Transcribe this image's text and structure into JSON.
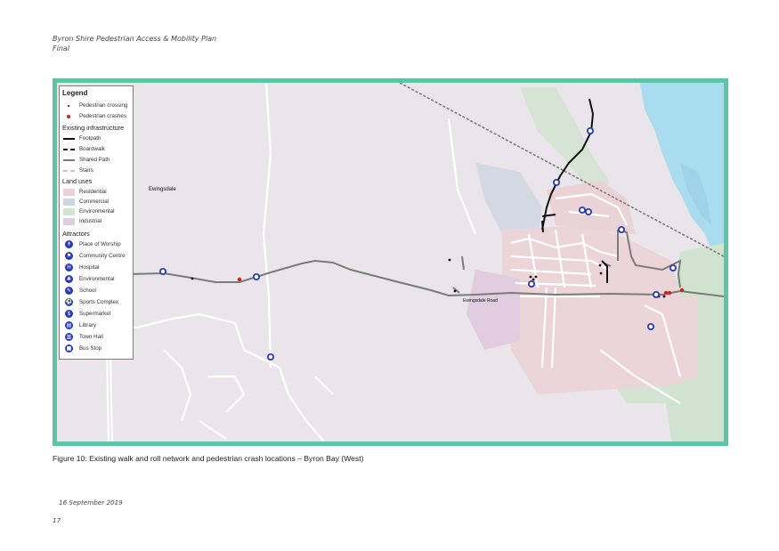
{
  "header": {
    "line1": "Byron Shire Pedestrian Access & Mobility Plan",
    "line2": "Final"
  },
  "map": {
    "legend": {
      "title": "Legend",
      "points": [
        {
          "label": "Pedestrian crossing",
          "color": "#111111"
        },
        {
          "label": "Pedestrian crashes",
          "color": "#d62020"
        }
      ],
      "infrastructure_title": "Existing infrastructure",
      "infrastructure": [
        {
          "label": "Footpath",
          "style": "solid-black"
        },
        {
          "label": "Boardwalk",
          "style": "dashed-black"
        },
        {
          "label": "Shared Path",
          "style": "solid-grey"
        },
        {
          "label": "Stairs",
          "style": "dashed-light"
        }
      ],
      "landuse_title": "Land uses",
      "landuses": [
        {
          "label": "Residential",
          "color": "#ecd2d4"
        },
        {
          "label": "Commercial",
          "color": "#cfd6e2"
        },
        {
          "label": "Environmental",
          "color": "#d4e4d2"
        },
        {
          "label": "Industrial",
          "color": "#e2cde0"
        }
      ],
      "attractors_title": "Attractors",
      "attractors": [
        {
          "label": "Place of Worship",
          "icon": "place-of-worship-icon",
          "glyph": "✝"
        },
        {
          "label": "Community Centre",
          "icon": "community-centre-icon",
          "glyph": "⚑"
        },
        {
          "label": "Hospital",
          "icon": "hospital-icon",
          "glyph": "H"
        },
        {
          "label": "Environmental",
          "icon": "environmental-icon",
          "glyph": "♣"
        },
        {
          "label": "School",
          "icon": "school-icon",
          "glyph": "✎"
        },
        {
          "label": "Sports Complex",
          "icon": "sports-complex-icon",
          "glyph": "⚽"
        },
        {
          "label": "Supermarket",
          "icon": "supermarket-icon",
          "glyph": "$"
        },
        {
          "label": "Library",
          "icon": "library-icon",
          "glyph": "▤"
        },
        {
          "label": "Town Hall",
          "icon": "town-hall-icon",
          "glyph": "▥"
        },
        {
          "label": "Bus Stop",
          "icon": "bus-stop-icon",
          "glyph": "■"
        }
      ]
    },
    "places": [
      {
        "name": "Ewingsdale"
      },
      {
        "name": "Ewingsdale Road"
      }
    ]
  },
  "caption": "Figure 10: Existing walk and roll network and pedestrian crash locations – Byron Bay (West)",
  "footer": {
    "date": "16 September 2019",
    "page": "17"
  }
}
